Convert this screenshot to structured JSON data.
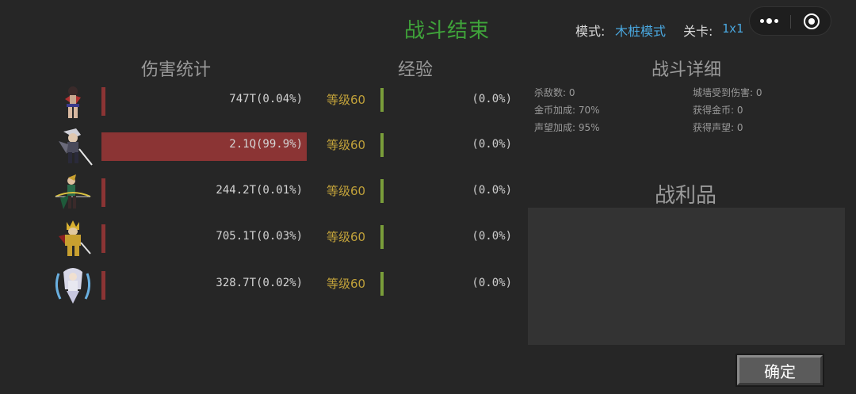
{
  "header": {
    "title": "战斗结束",
    "mode_label": "模式:",
    "mode_value": "木桩模式",
    "stage_label": "关卡:",
    "stage_value": "1x1"
  },
  "capsule": {
    "more_icon": "more-dots-icon",
    "close_icon": "target-close-icon"
  },
  "sections": {
    "damage": "伤害统计",
    "experience": "经验",
    "details": "战斗详细",
    "loot": "战利品"
  },
  "heroes": [
    {
      "avatar_icon": "hero-dancer-avatar",
      "damage_text": "747T(0.04%)",
      "damage_fraction": 0.0004,
      "level_text": "等级60",
      "exp_text": "(0.0%)",
      "exp_fraction": 0.0
    },
    {
      "avatar_icon": "hero-swordsman-avatar",
      "damage_text": "2.1Q(99.9%)",
      "damage_fraction": 0.999,
      "level_text": "等级60",
      "exp_text": "(0.0%)",
      "exp_fraction": 0.0
    },
    {
      "avatar_icon": "hero-archer-avatar",
      "damage_text": "244.2T(0.01%)",
      "damage_fraction": 0.0001,
      "level_text": "等级60",
      "exp_text": "(0.0%)",
      "exp_fraction": 0.0
    },
    {
      "avatar_icon": "hero-warrior-avatar",
      "damage_text": "705.1T(0.03%)",
      "damage_fraction": 0.0003,
      "level_text": "等级60",
      "exp_text": "(0.0%)",
      "exp_fraction": 0.0
    },
    {
      "avatar_icon": "hero-mage-avatar",
      "damage_text": "328.7T(0.02%)",
      "damage_fraction": 0.0002,
      "level_text": "等级60",
      "exp_text": "(0.0%)",
      "exp_fraction": 0.0
    }
  ],
  "details": {
    "kills": "杀敌数: 0",
    "wall_damage": "城墙受到伤害: 0",
    "gold_bonus": "金币加成: 70%",
    "gold_gained": "获得金币: 0",
    "fame_bonus": "声望加成: 95%",
    "fame_gained": "获得声望: 0"
  },
  "confirm_label": "确定",
  "colors": {
    "background": "#262626",
    "title": "#3fa33a",
    "link": "#4aa8e0",
    "damage_bar": "#8b3434",
    "level": "#c2a23a",
    "exp_bar": "#7a9e3a"
  }
}
